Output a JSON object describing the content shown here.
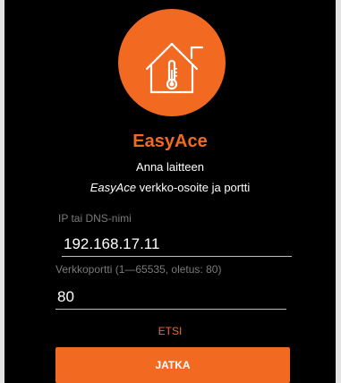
{
  "app": {
    "name": "EasyAce",
    "logo_icon": "house-thermometer-icon",
    "accent_color": "#f26a22"
  },
  "intro": {
    "line1": "Anna laitteen",
    "line2_brand": "EasyAce",
    "line2_rest": " verkko-osoite ja portti"
  },
  "ip_field": {
    "label": "IP tai DNS-nimi",
    "value": "192.168.17.11"
  },
  "port_field": {
    "label": "Verkkoportti (1—65535, oletus: 80)",
    "value": "80"
  },
  "actions": {
    "search_label": "ETSI",
    "continue_label": "JATKA"
  }
}
